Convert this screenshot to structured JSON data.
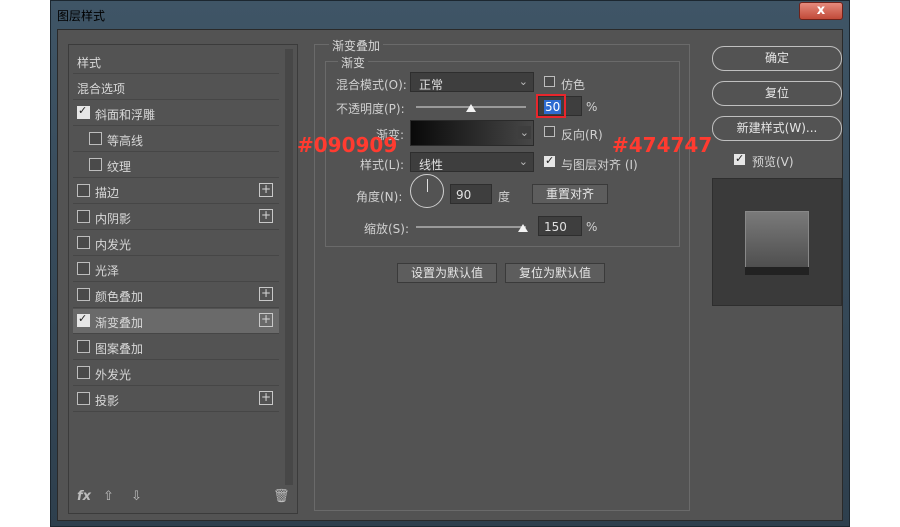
{
  "window": {
    "title": "图层样式",
    "close_label": "x"
  },
  "styles_list": {
    "header": "样式",
    "items": [
      {
        "label": "混合选项"
      },
      {
        "label": "斜面和浮雕",
        "checked": true
      },
      {
        "label": "等高线"
      },
      {
        "label": "纹理"
      },
      {
        "label": "描边",
        "plus": true
      },
      {
        "label": "内阴影",
        "plus": true
      },
      {
        "label": "内发光"
      },
      {
        "label": "光泽"
      },
      {
        "label": "颜色叠加",
        "plus": true
      },
      {
        "label": "渐变叠加",
        "checked": true,
        "plus": true,
        "selected": true
      },
      {
        "label": "图案叠加"
      },
      {
        "label": "外发光"
      },
      {
        "label": "投影",
        "plus": true
      }
    ],
    "footer": {
      "fx_label": "fx",
      "up_icon": "arrow-up-icon",
      "down_icon": "arrow-down-icon",
      "trash_icon": "trash-icon"
    }
  },
  "gradient_overlay": {
    "group_title": "渐变叠加",
    "sub_title": "渐变",
    "blend_mode_label": "混合模式(O):",
    "blend_mode_value": "正常",
    "dither_label": "仿色",
    "opacity_label": "不透明度(P):",
    "opacity_value": "50",
    "percent": "%",
    "gradient_label": "渐变:",
    "reverse_label": "反向(R)",
    "style_label": "样式(L):",
    "style_value": "线性",
    "align_label": "与图层对齐 (I)",
    "angle_label": "角度(N):",
    "angle_value": "90",
    "degree_label": "度",
    "reset_align_button": "重置对齐",
    "scale_label": "缩放(S):",
    "scale_value": "150",
    "set_default_button": "设置为默认值",
    "reset_default_button": "复位为默认值"
  },
  "annotations": {
    "left_color": "#090909",
    "right_color": "#474747"
  },
  "right_panel": {
    "ok_button": "确定",
    "reset_button": "复位",
    "new_style_button": "新建样式(W)...",
    "preview_label": "预览(V)",
    "preview_checked": true
  }
}
